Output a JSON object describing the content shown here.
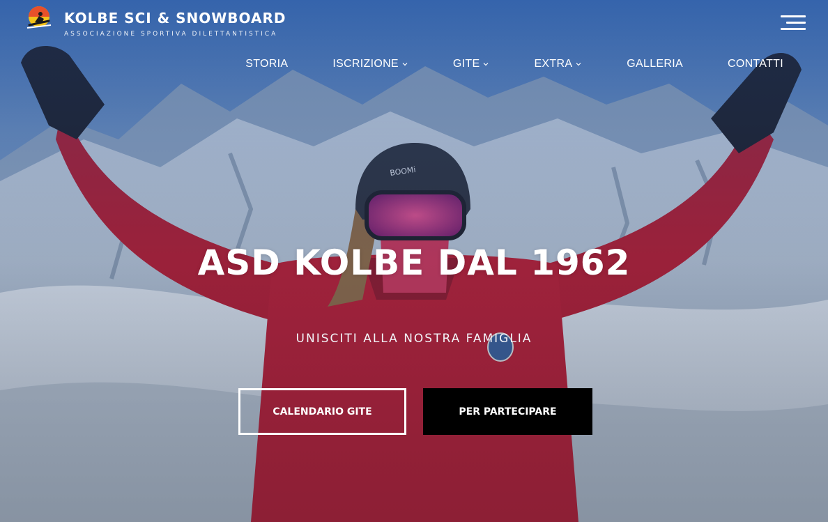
{
  "header": {
    "site_title": "KOLBE SCI & SNOWBOARD",
    "tagline": "ASSOCIAZIONE SPORTIVA DILETTANTISTICA",
    "logo_icon": "skier-sun-logo"
  },
  "nav": {
    "items": [
      {
        "label": "STORIA",
        "has_dropdown": false
      },
      {
        "label": "ISCRIZIONE",
        "has_dropdown": true
      },
      {
        "label": "GITE",
        "has_dropdown": true
      },
      {
        "label": "EXTRA",
        "has_dropdown": true
      },
      {
        "label": "GALLERIA",
        "has_dropdown": false
      },
      {
        "label": "CONTATTI",
        "has_dropdown": false
      }
    ],
    "menu_icon": "hamburger-menu-icon"
  },
  "hero": {
    "title": "ASD KOLBE DAL 1962",
    "subtitle": "UNISCITI ALLA NOSTRA FAMIGLIA",
    "primary_button": "CALENDARIO GITE",
    "secondary_button": "PER PARTECIPARE"
  },
  "colors": {
    "text": "#ffffff",
    "button_solid_bg": "#000000",
    "jacket_red": "#b8203a",
    "sky_blue": "#4d7fc4"
  }
}
